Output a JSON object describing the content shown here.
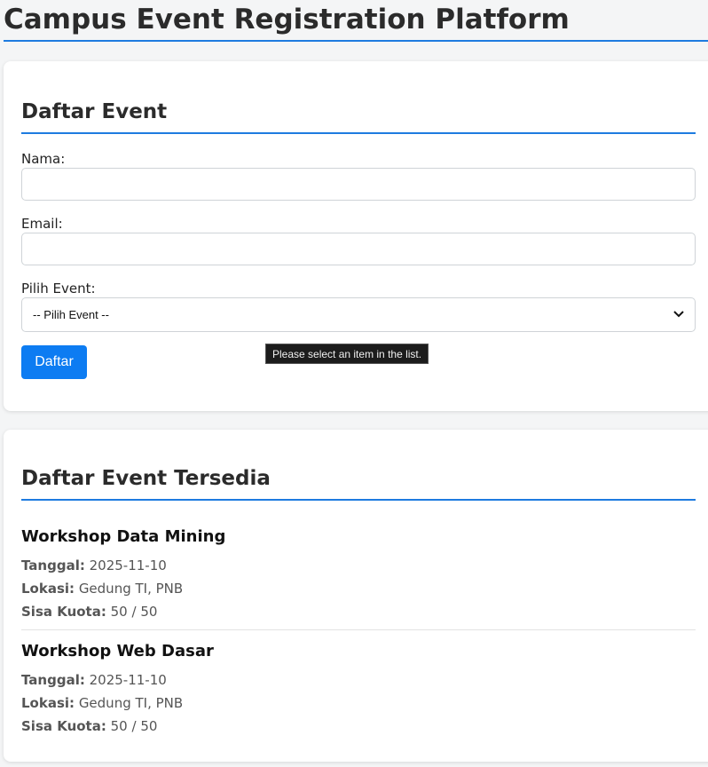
{
  "app": {
    "title": "Campus Event Registration Platform"
  },
  "form": {
    "title": "Daftar Event",
    "name_label": "Nama:",
    "name_value": "",
    "email_label": "Email:",
    "email_value": "",
    "event_label": "Pilih Event:",
    "event_selected": "-- Pilih Event --",
    "submit_label": "Daftar",
    "validation_tooltip": "Please select an item in the list."
  },
  "events_section": {
    "title": "Daftar Event Tersedia",
    "date_label": "Tanggal:",
    "location_label": "Lokasi:",
    "quota_label": "Sisa Kuota:",
    "events": [
      {
        "name": "Workshop Data Mining",
        "date": "2025-11-10",
        "location": "Gedung TI, PNB",
        "quota": "50 / 50"
      },
      {
        "name": "Workshop Web Dasar",
        "date": "2025-11-10",
        "location": "Gedung TI, PNB",
        "quota": "50 / 50"
      }
    ]
  },
  "colors": {
    "accent": "#1e7be0",
    "button": "#0d7cf2",
    "background": "#f4f5f6"
  },
  "icons": {
    "select_arrow": "chevron-down-icon"
  }
}
